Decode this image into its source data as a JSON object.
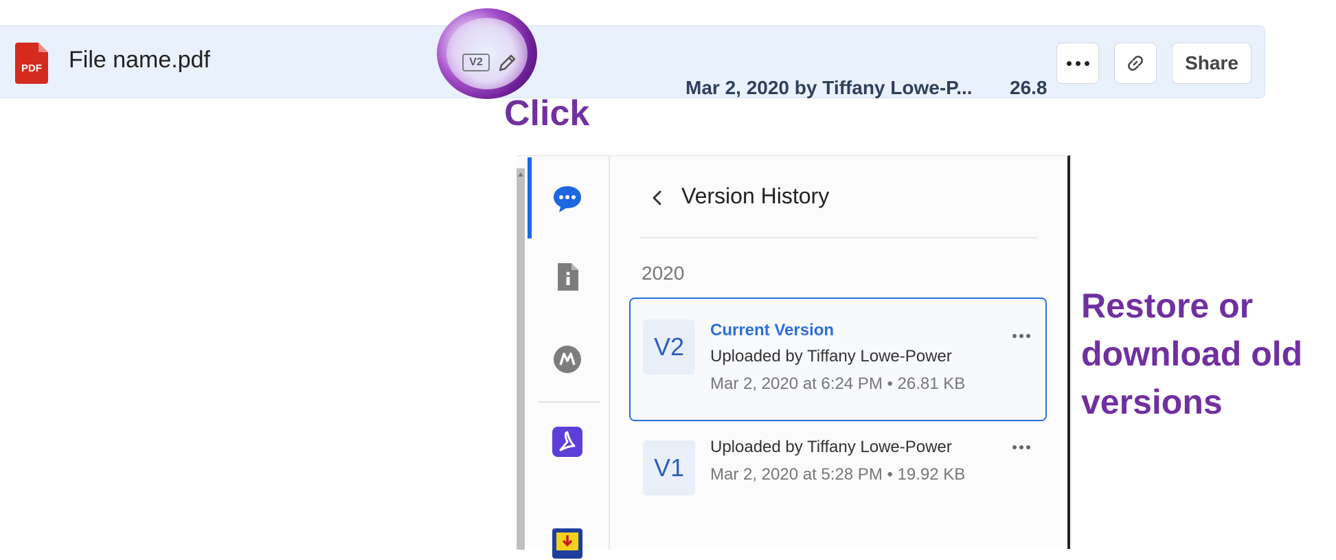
{
  "file_row": {
    "file_badge": "PDF",
    "file_name": "File name.pdf",
    "version_badge": "V2",
    "modified": "Mar 2, 2020 by Tiffany Lowe-P...",
    "size_truncated": "26.8",
    "share_label": "Share"
  },
  "annotations": {
    "click": "Click",
    "restore": "Restore or download old versions"
  },
  "version_history": {
    "title": "Version History",
    "year": "2020",
    "versions": [
      {
        "badge": "V2",
        "status": "Current Version",
        "uploaded_by": "Uploaded by Tiffany Lowe-Power",
        "meta": "Mar 2, 2020 at 6:24 PM • 26.81 KB"
      },
      {
        "badge": "V1",
        "uploaded_by": "Uploaded by Tiffany Lowe-Power",
        "meta": "Mar 2, 2020 at 5:28 PM • 19.92 KB"
      }
    ]
  },
  "colors": {
    "accent_blue": "#2d6fdb",
    "annotation_purple": "#7030a0",
    "row_background": "#e9f1fd",
    "pdf_red": "#d52b1e"
  },
  "icons": {
    "rail": [
      "comment-bubble-icon",
      "file-info-icon",
      "m-logo-icon",
      "adobe-acrobat-icon",
      "download-app-icon"
    ],
    "row": [
      "pdf-file-icon",
      "pencil-icon",
      "more-options-icon",
      "link-icon"
    ]
  }
}
